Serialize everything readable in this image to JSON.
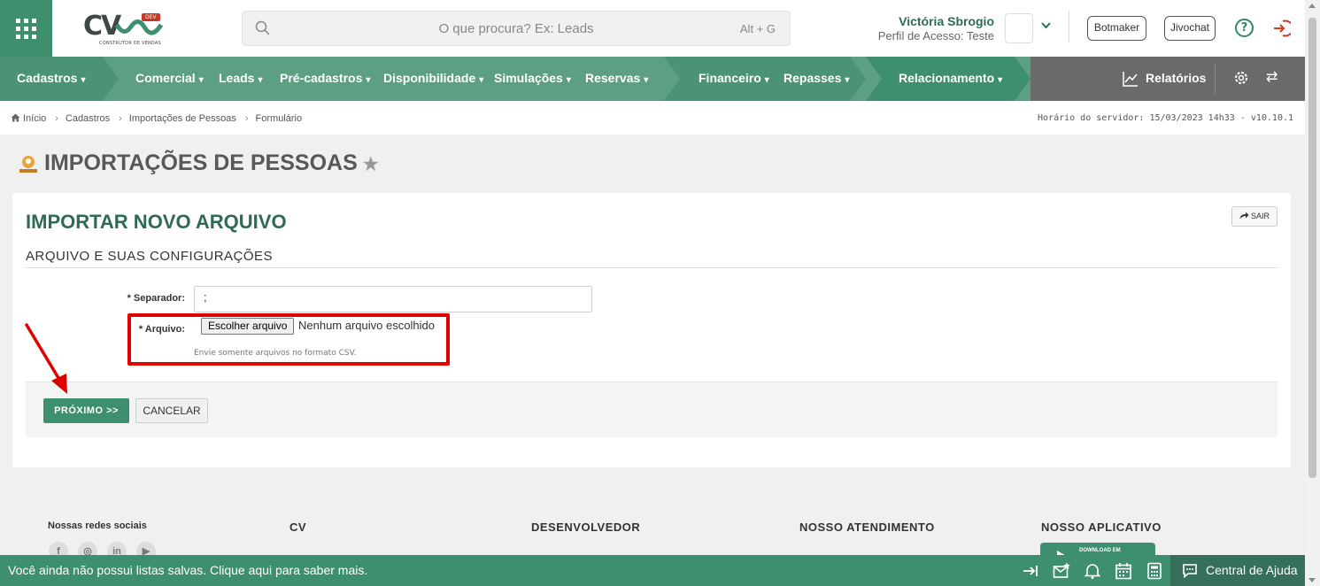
{
  "header": {
    "logo_text": "CV",
    "logo_badge": "DEV",
    "logo_sub": "CONSTRUTOR DE VENDAS",
    "search_placeholder": "O que procura? Ex: Leads",
    "search_shortcut": "Alt + G",
    "user_name": "Victória Sbrogio",
    "user_profile": "Perfil de Acesso: Teste",
    "botmaker_label": "Botmaker",
    "jivochat_label": "Jivochat",
    "help_glyph": "?"
  },
  "nav": {
    "items": [
      {
        "label": "Cadastros"
      },
      {
        "label": "Comercial"
      },
      {
        "label": "Leads"
      },
      {
        "label": "Pré-cadastros"
      },
      {
        "label": "Disponibilidade"
      },
      {
        "label": "Simulações"
      },
      {
        "label": "Reservas"
      },
      {
        "label": "Financeiro"
      },
      {
        "label": "Repasses"
      },
      {
        "label": "Relacionamento"
      }
    ],
    "relatorios_label": "Relatórios",
    "chevron": "⌄",
    "swap_glyph": "⇄"
  },
  "breadcrumb": {
    "items": [
      "Início",
      "Cadastros",
      "Importações de Pessoas",
      "Formulário"
    ],
    "separator": "›",
    "server_time": "Horário do servidor: 15/03/2023 14h33 - v10.10.1"
  },
  "page": {
    "title": "IMPORTAÇÕES DE PESSOAS",
    "star": "★"
  },
  "form": {
    "heading": "IMPORTAR NOVO ARQUIVO",
    "exit_label": "SAIR",
    "section_title": "ARQUIVO E SUAS CONFIGURAÇÕES",
    "separator_label": "* Separador:",
    "separator_value": ";",
    "file_label": "* Arquivo:",
    "file_button": "Escolher arquivo",
    "file_status": "Nenhum arquivo escolhido",
    "file_help": "Envie somente arquivos no formato CSV.",
    "next_label": "PRÓXIMO >>",
    "cancel_label": "CANCELAR"
  },
  "footer": {
    "social_title": "Nossas redes sociais",
    "social_icons": [
      "f",
      "◎",
      "in",
      "▶"
    ],
    "col_cv": "CV",
    "col_dev": "DESENVOLVEDOR",
    "col_atend": "NOSSO ATENDIMENTO",
    "col_app": "NOSSO APLICATIVO",
    "app_badge": "DOWNLOAD EM"
  },
  "bottombar": {
    "message": "Você ainda não possui listas salvas. Clique aqui para saber mais.",
    "help_center": "Central de Ajuda"
  },
  "colors": {
    "primary": "#3d8f6f",
    "nav": "#5c9f83",
    "highlight": "#e00000"
  }
}
